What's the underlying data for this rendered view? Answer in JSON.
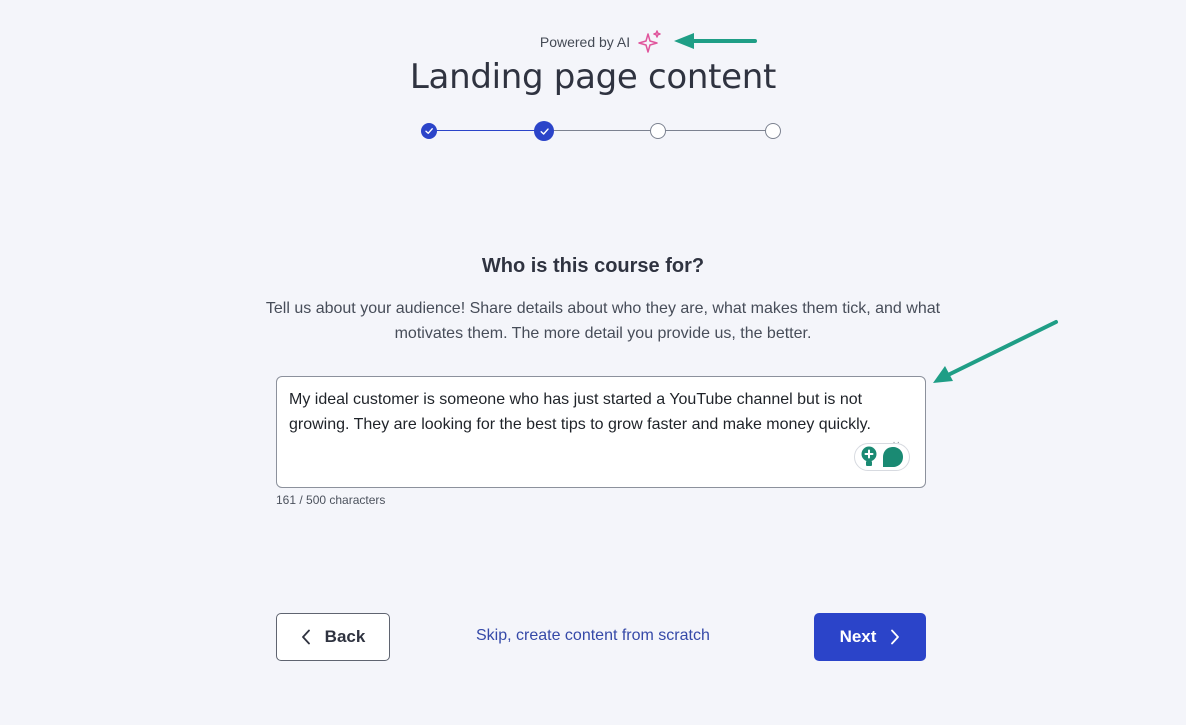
{
  "header": {
    "powered_by": "Powered by AI",
    "title": "Landing page content"
  },
  "stepper": {
    "steps": [
      {
        "status": "completed"
      },
      {
        "status": "completed"
      },
      {
        "status": "incomplete"
      },
      {
        "status": "incomplete"
      }
    ],
    "current_step": 2,
    "total_steps": 4
  },
  "question": {
    "heading": "Who is this course for?",
    "description": "Tell us about your audience! Share details about who they are, what makes them tick, and what motivates them. The more detail you provide us, the better."
  },
  "audience_input": {
    "value": "My ideal customer is someone who has just started a YouTube channel but is not growing. They are looking for the best tips to grow faster and make money quickly.",
    "char_count": "161 / 500 characters"
  },
  "footer": {
    "back_label": "Back",
    "skip_label": "Skip, create content from scratch",
    "next_label": "Next"
  },
  "icons": {
    "sparkle": "sparkle-icon",
    "check": "check-icon",
    "chevron_left": "chevron-left-icon",
    "chevron_right": "chevron-right-icon",
    "extension": "writing-assistant-icon"
  },
  "colors": {
    "background": "#f4f5fa",
    "primary": "#2b44c9",
    "link": "#3549a8",
    "sparkle": "#e0559c",
    "annotation_arrow": "#1f9e86",
    "extension": "#1a8a73"
  }
}
